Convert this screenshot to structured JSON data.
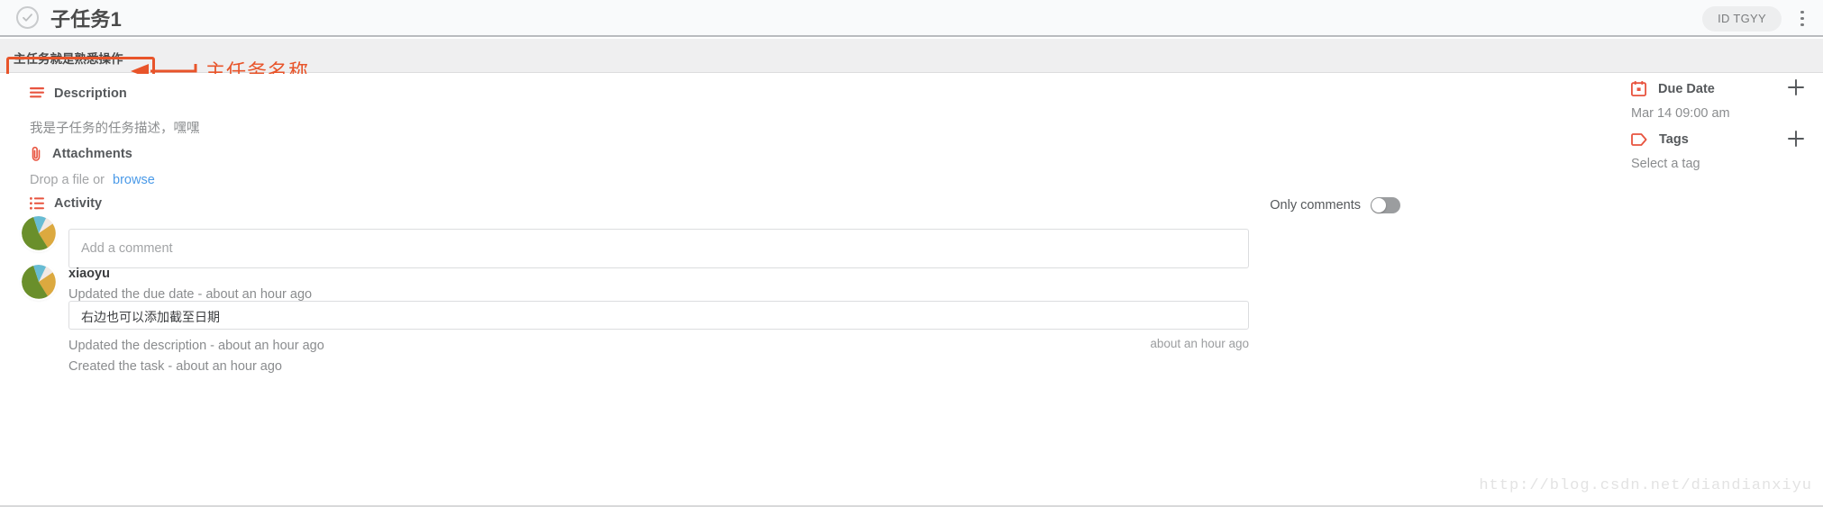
{
  "header": {
    "status_icon": "check-circle-icon",
    "title": "子任务1",
    "id_badge": "ID TGYY",
    "menu_icon": "kebab-menu-icon"
  },
  "breadcrumb": {
    "parent_task": "主任务就是熟悉操作"
  },
  "annotation": {
    "label": "主任务名称",
    "color": "#e8542a"
  },
  "main": {
    "description": {
      "icon": "description-lines-icon",
      "heading": "Description",
      "text": "我是子任务的任务描述，嘿嘿"
    },
    "attachments": {
      "icon": "paperclip-icon",
      "heading": "Attachments",
      "drop_text": "Drop a file or",
      "browse_label": "browse"
    },
    "activity": {
      "icon": "activity-list-icon",
      "heading": "Activity",
      "only_comments_label": "Only comments",
      "only_comments_on": false,
      "comment_placeholder": "Add a comment",
      "entries": [
        {
          "user": "xiaoyu",
          "action": "Updated the due date  -  about an hour ago",
          "bubble_text": "右边也可以添加截至日期",
          "bubble_time": "about an hour ago"
        },
        {
          "action": "Updated the description  -  about an hour ago"
        },
        {
          "action": "Created the task  -  about an hour ago"
        }
      ]
    }
  },
  "sidebar": {
    "due_date": {
      "icon": "calendar-icon",
      "heading": "Due Date",
      "value": "Mar 14 09:00 am",
      "add_icon": "plus-icon"
    },
    "tags": {
      "icon": "tag-icon",
      "heading": "Tags",
      "value": "Select a tag",
      "add_icon": "plus-icon"
    }
  },
  "watermark": {
    "text": "http://blog.csdn.net/diandianxiyu"
  },
  "colors": {
    "accent_red": "#e8543f",
    "link_blue": "#4a9ae8",
    "annotation_orange": "#e8542a"
  }
}
